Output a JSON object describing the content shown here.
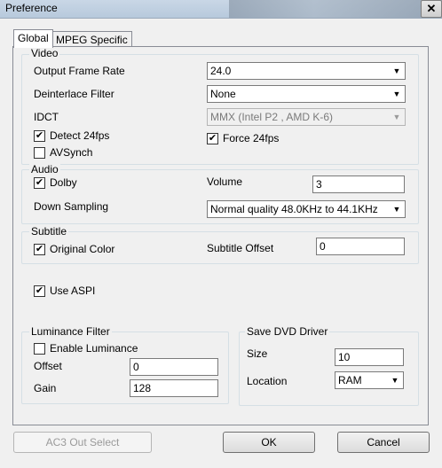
{
  "window": {
    "title": "Preference",
    "close_glyph": "✕"
  },
  "tabs": [
    {
      "label": "Global"
    },
    {
      "label": "MPEG Specific"
    }
  ],
  "video": {
    "title": "Video",
    "output_frame_rate_label": "Output Frame Rate",
    "output_frame_rate_value": "24.0",
    "deinterlace_label": "Deinterlace Filter",
    "deinterlace_value": "None",
    "idct_label": "IDCT",
    "idct_value": "MMX (Intel P2 , AMD K-6)",
    "detect24_label": "Detect 24fps",
    "detect24_checked": true,
    "force24_label": "Force 24fps",
    "force24_checked": true,
    "avsynch_label": "AVSynch",
    "avsynch_checked": false
  },
  "audio": {
    "title": "Audio",
    "dolby_label": "Dolby",
    "dolby_checked": true,
    "volume_label": "Volume",
    "volume_value": "3",
    "downsampling_label": "Down Sampling",
    "downsampling_value": "Normal quality 48.0KHz to 44.1KHz"
  },
  "subtitle": {
    "title": "Subtitle",
    "original_color_label": "Original Color",
    "original_color_checked": true,
    "offset_label": "Subtitle Offset",
    "offset_value": "0"
  },
  "use_aspi": {
    "label": "Use ASPI",
    "checked": true
  },
  "luminance": {
    "title": "Luminance Filter",
    "enable_label": "Enable Luminance",
    "enable_checked": false,
    "offset_label": "Offset",
    "offset_value": "0",
    "gain_label": "Gain",
    "gain_value": "128"
  },
  "dvd_driver": {
    "title": "Save DVD Driver",
    "size_label": "Size",
    "size_value": "10",
    "location_label": "Location",
    "location_value": "RAM"
  },
  "buttons": {
    "ac3": "AC3 Out Select",
    "ok": "OK",
    "cancel": "Cancel"
  },
  "glyphs": {
    "check": "✔",
    "arrow": "▼"
  }
}
